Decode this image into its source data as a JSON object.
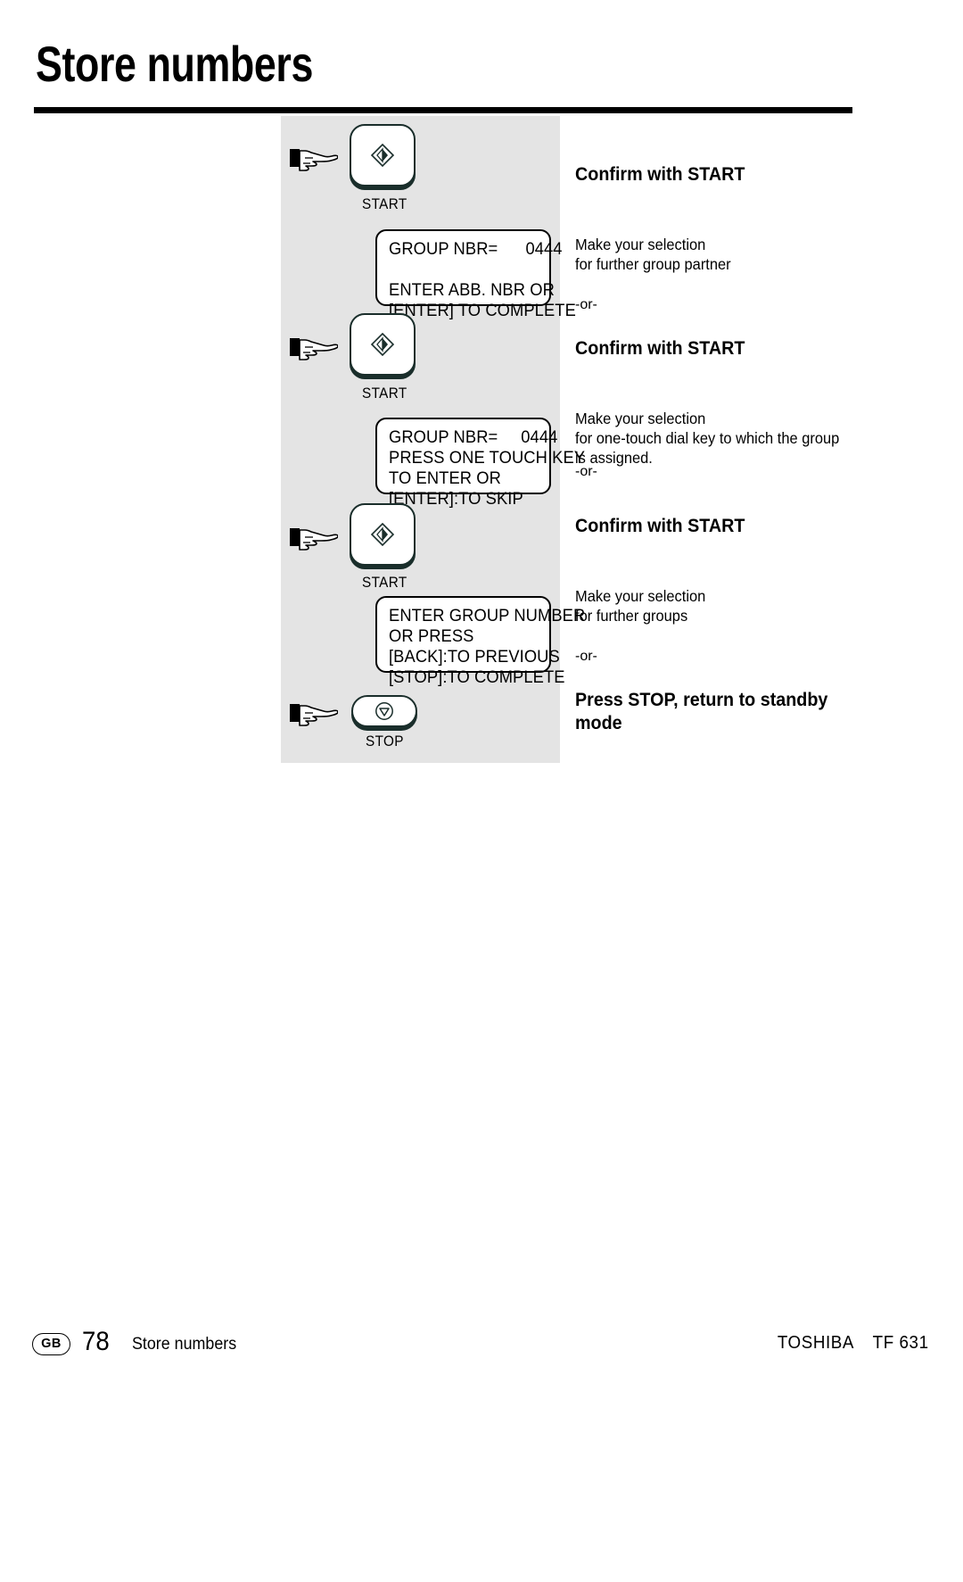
{
  "header": {
    "title": "Store numbers"
  },
  "diagram": {
    "steps": [
      {
        "key": {
          "type": "start-key",
          "label": "START",
          "icon": "start-diamond-icon"
        }
      },
      {
        "display": {
          "name": "lcd-display-1",
          "lines": [
            "GROUP NBR=      0444",
            "",
            "ENTER ABB. NBR OR",
            "[ENTER] TO COMPLETE"
          ]
        }
      },
      {
        "key": {
          "type": "start-key",
          "label": "START",
          "icon": "start-diamond-icon"
        }
      },
      {
        "display": {
          "name": "lcd-display-2",
          "lines": [
            "GROUP NBR=     0444",
            "PRESS ONE TOUCH KEY",
            "TO ENTER OR",
            "[ENTER]:TO SKIP"
          ]
        }
      },
      {
        "key": {
          "type": "start-key",
          "label": "START",
          "icon": "start-diamond-icon"
        }
      },
      {
        "display": {
          "name": "lcd-display-3",
          "lines": [
            "ENTER GROUP NUMBER",
            "OR PRESS",
            "[BACK]:TO PREVIOUS",
            "[STOP]:TO COMPLETE"
          ]
        }
      },
      {
        "key": {
          "type": "stop-key",
          "label": "STOP",
          "icon": "stop-triangle-icon"
        }
      }
    ]
  },
  "notes": {
    "confirm_1": "Confirm with START",
    "selection_1": "Make your selection\nfor further group partner",
    "or_1": "-or-",
    "confirm_2": "Confirm with START",
    "selection_2": "Make your selection\nfor one-touch dial key to which the group\nis assigned.",
    "or_2": "-or-",
    "confirm_3": "Confirm with START",
    "selection_3": "Make your selection\nfor further groups",
    "or_3": "-or-",
    "stop_note": "Press STOP, return to standby\nmode"
  },
  "footer": {
    "language": "GB",
    "page_number": "78",
    "section": "Store numbers",
    "brand": "TOSHIBA",
    "model": "TF 631"
  }
}
